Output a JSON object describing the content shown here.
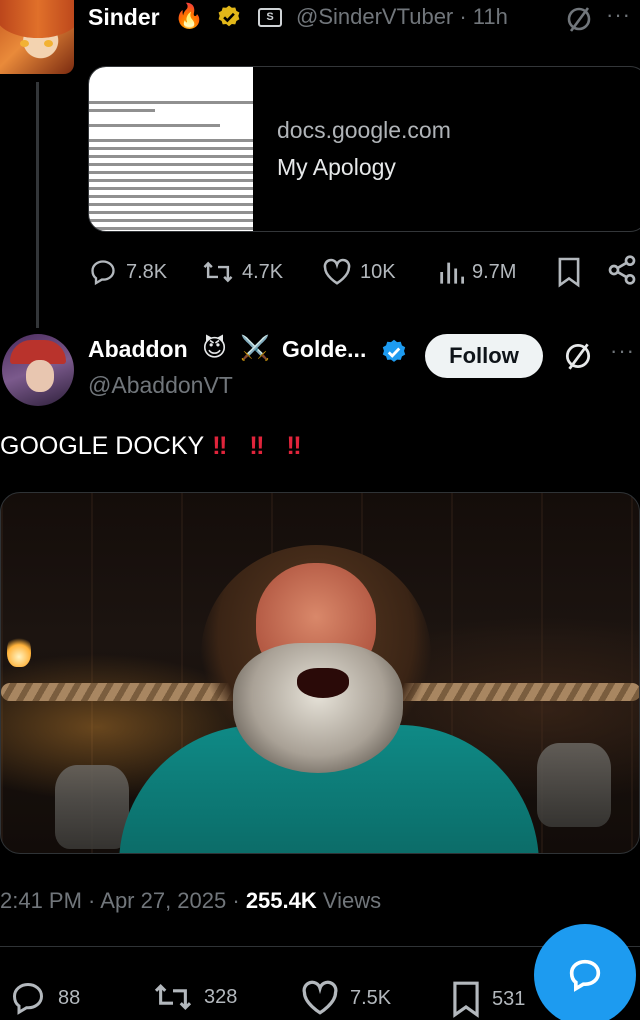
{
  "parent_tweet": {
    "name": "Sinder",
    "handle_time": "@SinderVTuber · 11h",
    "subscriber_badge": "S",
    "fire_emoji": "🔥",
    "more": "···",
    "link_card": {
      "domain": "docs.google.com",
      "title": "My Apology"
    },
    "stats": {
      "replies": "7.8K",
      "reposts": "4.7K",
      "likes": "10K",
      "views": "9.7M"
    }
  },
  "main_tweet": {
    "name": "Abaddon",
    "emoji_1": "😈",
    "emoji_2": "⚔️",
    "name_suffix": "Golde...",
    "handle": "@AbaddonVT",
    "follow_label": "Follow",
    "more": "···",
    "text": "GOOGLE DOCKY",
    "exclamations": [
      "‼",
      "‼",
      "‼"
    ],
    "timestamp": "2:41 PM · Apr 27, 2025 · ",
    "views_count": "255.4K",
    "views_label": " Views",
    "stats": {
      "replies": "88",
      "reposts": "328",
      "likes": "7.5K",
      "bookmarks": "531"
    }
  },
  "colors": {
    "background": "#000000",
    "muted_text": "#71767b",
    "accent_blue": "#1d9bf0",
    "verified_gold": "#e2b719",
    "exclamation_red": "#e0243b"
  }
}
